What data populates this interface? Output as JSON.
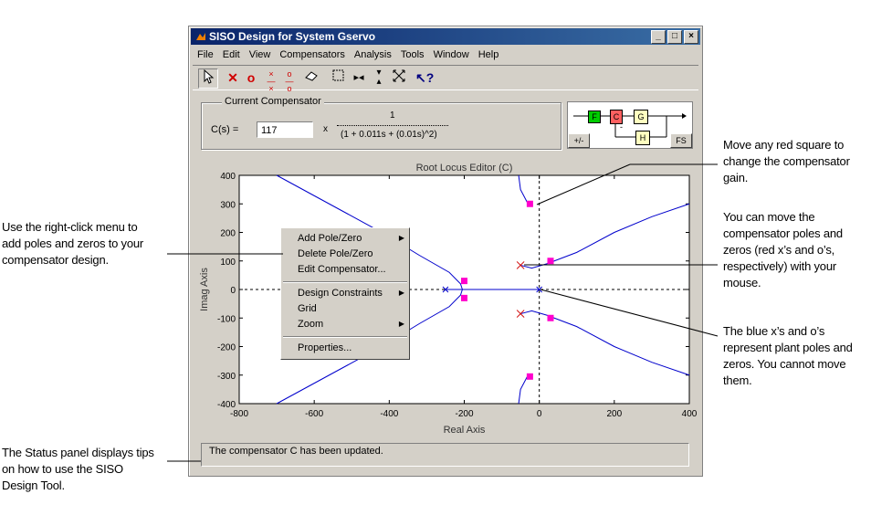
{
  "window": {
    "title": "SISO Design for System Gservo",
    "buttons": {
      "minimize": "_",
      "maximize": "□",
      "close": "×"
    }
  },
  "menubar": [
    "File",
    "Edit",
    "View",
    "Compensators",
    "Analysis",
    "Tools",
    "Window",
    "Help"
  ],
  "toolbar": {
    "icons": [
      "select-arrow-icon",
      "add-real-pole-icon",
      "add-real-zero-icon",
      "add-complex-pole-icon",
      "add-complex-zero-icon",
      "eraser-icon",
      "zoom-xy-icon",
      "zoom-x-icon",
      "zoom-y-icon",
      "zoom-fit-icon",
      "help-icon"
    ]
  },
  "compensator": {
    "panel_label": "Current Compensator",
    "c_label": "C(s) =",
    "gain_value": "117",
    "times": "x",
    "numerator": "1",
    "denominator": "(1 + 0.011s + (0.01s)^2)"
  },
  "block_diagram": {
    "blocks": [
      "F",
      "C",
      "G",
      "H"
    ],
    "sign_button": "+/-",
    "fs_button": "FS"
  },
  "plot": {
    "title": "Root Locus Editor (C)",
    "xlabel": "Real Axis",
    "ylabel": "Imag Axis",
    "xticks": [
      "-800",
      "-600",
      "-400",
      "-200",
      "0",
      "200",
      "400"
    ],
    "yticks": [
      "400",
      "300",
      "200",
      "100",
      "0",
      "-100",
      "-200",
      "-300",
      "-400"
    ],
    "minus_sign": "-"
  },
  "context_menu": {
    "items": [
      "Add Pole/Zero",
      "Delete Pole/Zero",
      "Edit Compensator...",
      "Design Constraints",
      "Grid",
      "Zoom",
      "Properties..."
    ]
  },
  "status": {
    "text": "The compensator C has been updated."
  },
  "callouts": {
    "right_click": "Use the right-click menu to\nadd poles and zeros to your\ncompensator design.",
    "status_panel": "The Status panel displays tips\non how to use the SISO\nDesign Tool.",
    "red_square": "Move any red square to\nchange the compensator\ngain.",
    "move_poles": "You can move the\ncompensator poles and\nzeros (red x’s and o’s,\nrespectively) with your\nmouse.",
    "blue_marks": "The blue x’s and o’s\nrepresent plant poles and\nzeros. You cannot move\nthem."
  },
  "colors": {
    "locus": "#0000cc",
    "compensator": "#d00000",
    "gain_marker": "#ff00cc",
    "titlebar": "#0a246a"
  }
}
